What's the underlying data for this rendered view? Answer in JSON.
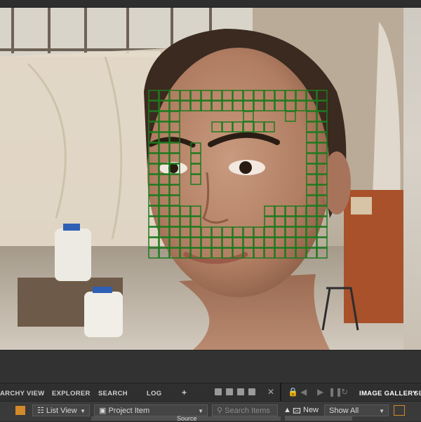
{
  "viewer": {
    "image_icon": "portrait-photo",
    "overlay_color": "#1e7a1e"
  },
  "panel_tabs": [
    {
      "label": "ARCHY VIEW"
    },
    {
      "label": "EXPLORER"
    },
    {
      "label": "SEARCH"
    },
    {
      "label": "LOG"
    },
    {
      "label": "+"
    }
  ],
  "gallery": {
    "tab_label": "IMAGE GALLERY",
    "extra_tab": "SE",
    "new_label": "New",
    "filter_value": "Show All"
  },
  "toolbar": {
    "view_mode": "List View",
    "item_filter": "Project Item",
    "search_placeholder": "Search Items",
    "source_label": "Source"
  }
}
